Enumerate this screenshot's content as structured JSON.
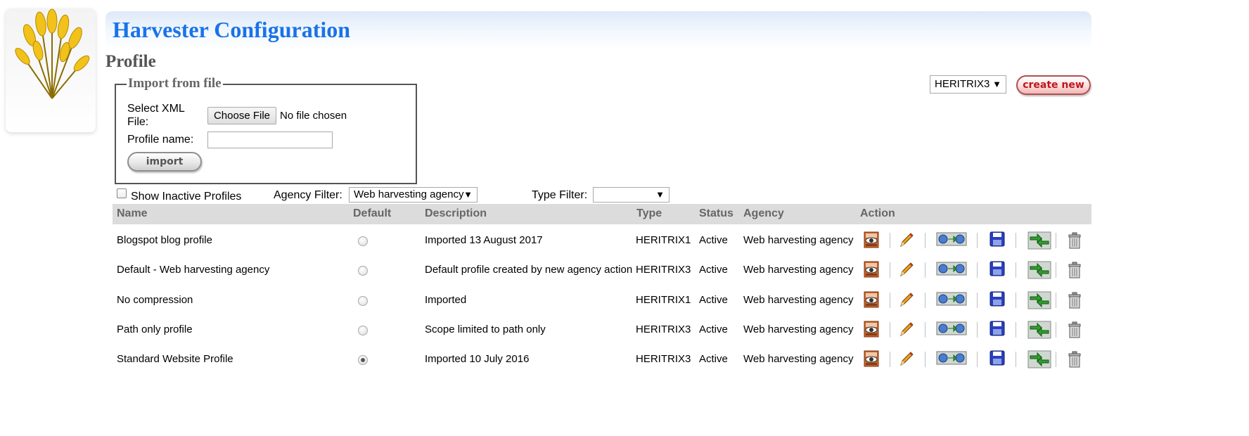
{
  "header": {
    "title": "Harvester Configuration"
  },
  "page": {
    "title": "Profile"
  },
  "import_section": {
    "legend": "Import from file",
    "select_xml_label_line1": "Select XML",
    "select_xml_label_line2": "File:",
    "choose_file_label": "Choose File",
    "no_file_text": "No file chosen",
    "profile_name_label": "Profile name:",
    "profile_name_value": "",
    "import_label": "import"
  },
  "toolbar": {
    "type_select_value": "HERITRIX3",
    "create_new_label": "create new"
  },
  "filters": {
    "show_inactive_label": "Show Inactive Profiles",
    "show_inactive_checked": false,
    "agency_filter_label": "Agency Filter:",
    "agency_filter_value": "Web harvesting agency",
    "type_filter_label": "Type Filter:",
    "type_filter_value": ""
  },
  "table": {
    "headers": [
      "Name",
      "Default",
      "Description",
      "Type",
      "Status",
      "Agency",
      "Action"
    ],
    "rows": [
      {
        "name": "Blogspot blog profile",
        "default": false,
        "description": "Imported 13 August 2017",
        "type": "HERITRIX1",
        "status": "Active",
        "agency": "Web harvesting agency"
      },
      {
        "name": "Default - Web harvesting agency",
        "default": false,
        "description": "Default profile created by new agency action",
        "type": "HERITRIX3",
        "status": "Active",
        "agency": "Web harvesting agency"
      },
      {
        "name": "No compression",
        "default": false,
        "description": "Imported",
        "type": "HERITRIX1",
        "status": "Active",
        "agency": "Web harvesting agency"
      },
      {
        "name": "Path only profile",
        "default": false,
        "description": "Scope limited to path only",
        "type": "HERITRIX3",
        "status": "Active",
        "agency": "Web harvesting agency"
      },
      {
        "name": "Standard Website Profile",
        "default": true,
        "description": "Imported 10 July 2016",
        "type": "HERITRIX3",
        "status": "Active",
        "agency": "Web harvesting agency"
      }
    ],
    "action_icons": [
      "view-icon",
      "edit-icon",
      "copy-icon",
      "save-icon",
      "transfer-icon",
      "delete-icon"
    ]
  },
  "colors": {
    "title_blue": "#1a73e8",
    "header_gray": "#dcdcdc",
    "create_red": "#c0151b"
  }
}
